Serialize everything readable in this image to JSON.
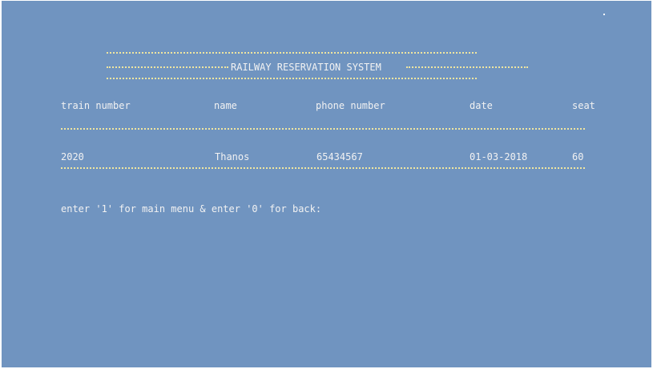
{
  "header": {
    "title": "RAILWAY RESERVATION SYSTEM"
  },
  "table": {
    "columns": [
      "train number",
      "name",
      "phone number",
      "date",
      "seat"
    ],
    "rows": [
      [
        "2020",
        "Thanos",
        "65434567",
        "01-03-2018",
        "60"
      ]
    ]
  },
  "prompt": "enter '1' for main menu & enter '0' for back:",
  "colors": {
    "background": "#7094c0",
    "text": "#f2f2f2",
    "dashes": "#f0e6a0"
  }
}
